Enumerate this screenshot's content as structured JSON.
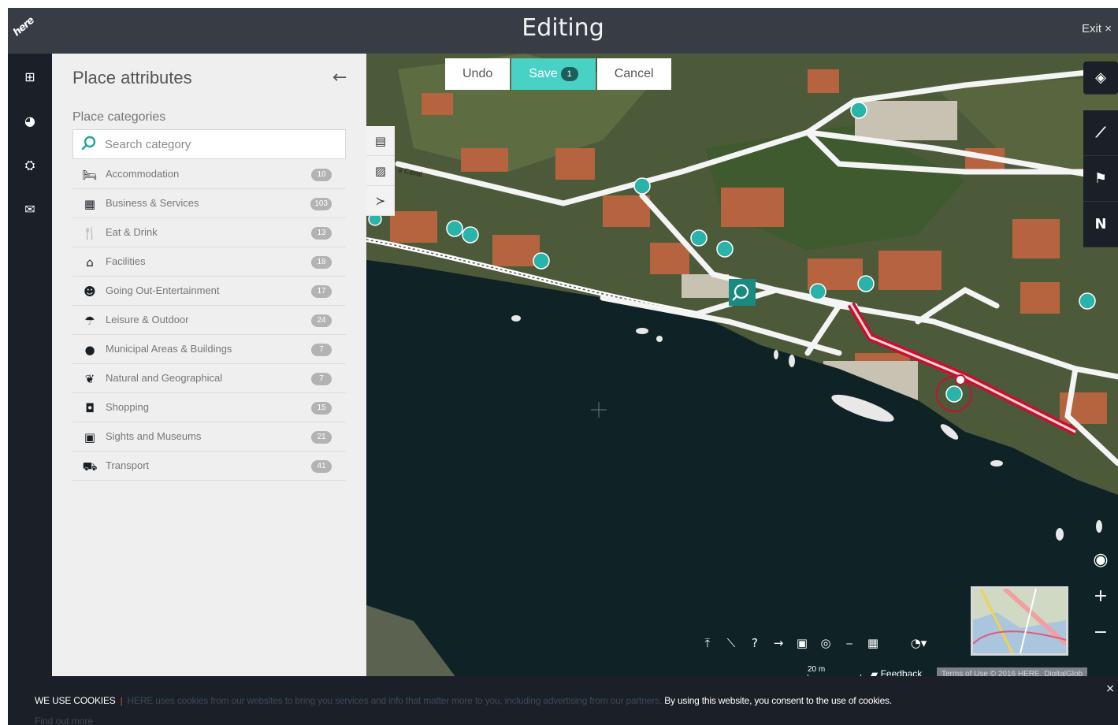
{
  "app": {
    "logo": "here",
    "title": "Editing",
    "exit_label": "Exit",
    "exit_icon": "×"
  },
  "rail": {
    "items": [
      {
        "name": "grid-icon",
        "glyph": "⊞"
      },
      {
        "name": "pie-icon",
        "glyph": "◕"
      },
      {
        "name": "community-icon",
        "glyph": "⛭"
      },
      {
        "name": "mail-icon",
        "glyph": "✉"
      }
    ]
  },
  "panel": {
    "title": "Place attributes",
    "back_icon": "←",
    "categories_label": "Place categories",
    "search_placeholder": "Search category",
    "categories": [
      {
        "label": "Accommodation",
        "icon": "🛏",
        "count": "10"
      },
      {
        "label": "Business & Services",
        "icon": "▦",
        "count": "103"
      },
      {
        "label": "Eat & Drink",
        "icon": "🍴",
        "count": "13"
      },
      {
        "label": "Facilities",
        "icon": "⌂",
        "count": "18"
      },
      {
        "label": "Going Out-Entertainment",
        "icon": "☻",
        "count": "17"
      },
      {
        "label": "Leisure & Outdoor",
        "icon": "☂",
        "count": "24"
      },
      {
        "label": "Municipal Areas & Buildings",
        "icon": "●",
        "count": "7"
      },
      {
        "label": "Natural and Geographical",
        "icon": "❦",
        "count": "7"
      },
      {
        "label": "Shopping",
        "icon": "◘",
        "count": "15"
      },
      {
        "label": "Sights and Museums",
        "icon": "▣",
        "count": "21"
      },
      {
        "label": "Transport",
        "icon": "⛟",
        "count": "41"
      }
    ]
  },
  "edit_bar": {
    "undo": "Undo",
    "save": "Save",
    "save_count": "1",
    "cancel": "Cancel"
  },
  "map": {
    "road_label": "a Caval",
    "scale_label": "20 m",
    "feedback": "Feedback",
    "terms": "Terms of Use © 2016 HERE, DigitalGlob"
  },
  "cookie": {
    "title": "WE USE COOKIES",
    "separator": "|",
    "text": "HERE uses cookies from our websites to bring you services and info that matter more to you, including advertising from our partners.",
    "consent": "By using this website, you consent to the use of cookies.",
    "more": "Find out more",
    "close": "×"
  },
  "colors": {
    "accent": "#48d1c5",
    "dark": "#1b1f27",
    "topbar": "#383c45",
    "route": "#c8102e"
  }
}
